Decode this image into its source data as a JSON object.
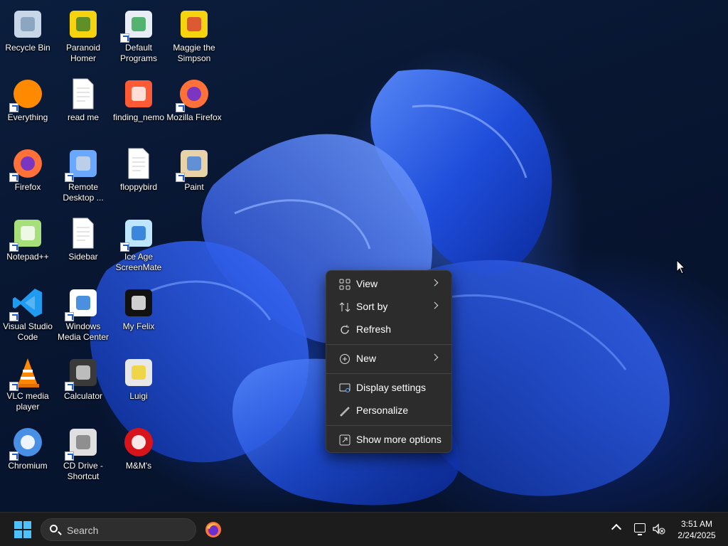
{
  "desktop": {
    "icons": [
      {
        "label": "Recycle Bin",
        "icon": "recycle-bin-icon"
      },
      {
        "label": "Paranoid Homer",
        "icon": "homer-icon"
      },
      {
        "label": "Default Programs",
        "icon": "default-programs-icon"
      },
      {
        "label": "Maggie the Simpson",
        "icon": "maggie-icon"
      },
      {
        "label": "Everything",
        "icon": "everything-search-icon"
      },
      {
        "label": "read me",
        "icon": "text-file-icon"
      },
      {
        "label": "finding_nemo",
        "icon": "nemo-fish-icon"
      },
      {
        "label": "Mozilla Firefox",
        "icon": "firefox-icon"
      },
      {
        "label": "Firefox",
        "icon": "firefox-icon"
      },
      {
        "label": "Remote Desktop ...",
        "icon": "remote-desktop-icon"
      },
      {
        "label": "floppybird",
        "icon": "file-icon"
      },
      {
        "label": "Paint",
        "icon": "paint-palette-icon"
      },
      {
        "label": "Notepad++",
        "icon": "notepad-plus-plus-icon"
      },
      {
        "label": "Sidebar",
        "icon": "file-icon"
      },
      {
        "label": "Ice Age ScreenMate",
        "icon": "ice-age-icon"
      },
      {
        "label": "Visual Studio Code",
        "icon": "vscode-icon"
      },
      {
        "label": "Windows Media Center",
        "icon": "media-center-icon"
      },
      {
        "label": "My Felix",
        "icon": "cat-icon"
      },
      {
        "label": "VLC media player",
        "icon": "vlc-cone-icon"
      },
      {
        "label": "Calculator",
        "icon": "calculator-icon"
      },
      {
        "label": "Luigi",
        "icon": "monitor-character-icon"
      },
      {
        "label": "Chromium",
        "icon": "chromium-icon"
      },
      {
        "label": "CD Drive - Shortcut",
        "icon": "cd-drive-icon"
      },
      {
        "label": "M&M's",
        "icon": "mm-candy-icon"
      }
    ]
  },
  "context_menu": {
    "items": [
      {
        "label": "View",
        "icon": "grid-view-icon",
        "submenu": true
      },
      {
        "label": "Sort by",
        "icon": "sort-icon",
        "submenu": true
      },
      {
        "label": "Refresh",
        "icon": "refresh-icon",
        "submenu": false
      },
      {
        "label": "New",
        "icon": "plus-circle-icon",
        "submenu": true
      },
      {
        "label": "Display settings",
        "icon": "display-settings-icon",
        "submenu": false
      },
      {
        "label": "Personalize",
        "icon": "pen-icon",
        "submenu": false
      },
      {
        "label": "Show more options",
        "icon": "more-options-icon",
        "submenu": false
      }
    ]
  },
  "taskbar": {
    "search_placeholder": "Search",
    "time": "3:51 AM",
    "date": "2/24/2025"
  },
  "colors": {
    "accent": "#4cc2ff",
    "menu_bg": "#2c2c2c",
    "taskbar_bg": "#1c1c1c"
  }
}
